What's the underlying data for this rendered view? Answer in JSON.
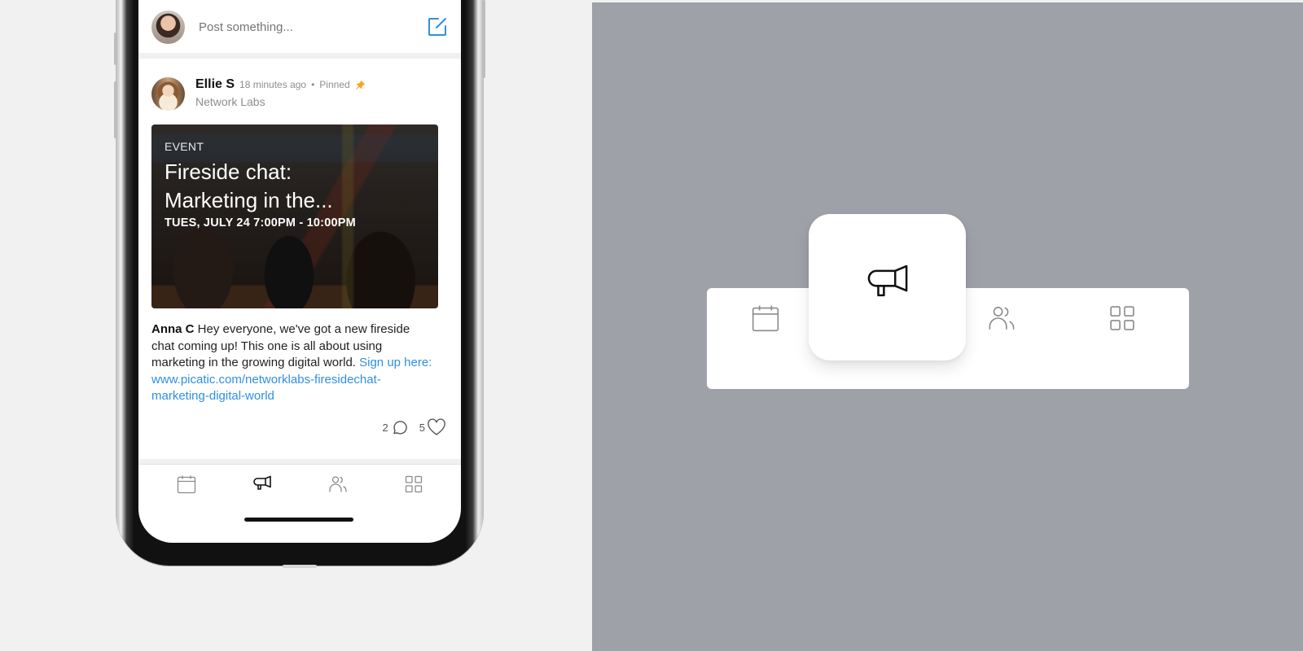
{
  "composer": {
    "placeholder": "Post something...",
    "avatar_icon": "user-avatar",
    "compose_icon": "compose-icon"
  },
  "post": {
    "author": "Ellie S",
    "time": "18 minutes ago",
    "separator": "•",
    "pinned_label": "Pinned",
    "pin_icon": "pin-icon",
    "pin_color": "#f5a623",
    "group": "Network Labs",
    "event": {
      "tag": "EVENT",
      "title_line1": "Fireside chat:",
      "title_line2": "Marketing in the...",
      "date": "TUES, JULY 24 7:00PM - 10:00PM"
    },
    "body": {
      "mention": "Anna C",
      "text": " Hey everyone, we've got a new fireside chat coming up! This one is all about using marketing in the growing digital world. ",
      "link_text": "Sign up here: www.picatic.com/networklabs-firesidechat-marketing-digital-world",
      "link_color": "#2f8fe0"
    },
    "comments_count": "2",
    "likes_count": "5"
  },
  "tabbar": {
    "tabs": [
      {
        "name": "events",
        "icon": "calendar-icon",
        "active": false
      },
      {
        "name": "announcements",
        "icon": "megaphone-icon",
        "active": true
      },
      {
        "name": "people",
        "icon": "users-icon",
        "active": false
      },
      {
        "name": "more",
        "icon": "grid-icon",
        "active": false
      }
    ]
  },
  "colors": {
    "accent": "#2f8fe0",
    "panel_bg": "#9fa1a9",
    "page_bg": "#f1f1f1",
    "icon_inactive": "#8a8a8a",
    "icon_active": "#111111"
  }
}
